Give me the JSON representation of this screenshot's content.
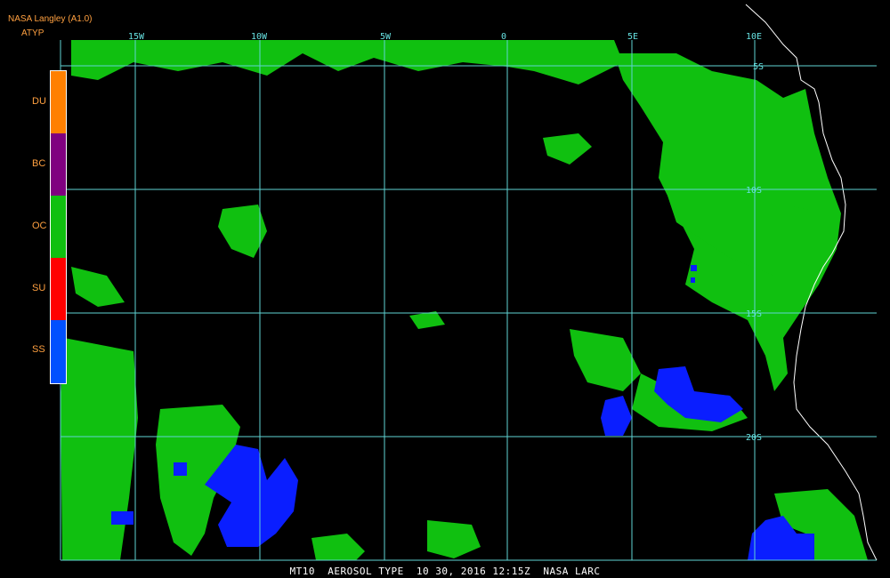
{
  "header": {
    "title": "NASA Langley (A1.0)",
    "subtitle": "ATYP"
  },
  "legend": {
    "items": [
      {
        "label": "DU",
        "color": "#ff8000"
      },
      {
        "label": "BC",
        "color": "#800080"
      },
      {
        "label": "OC",
        "color": "#10c010"
      },
      {
        "label": "SU",
        "color": "#ff0000"
      },
      {
        "label": "SS",
        "color": "#0050ff"
      }
    ]
  },
  "grid": {
    "lon_labels": [
      "15W",
      "10W",
      "5W",
      "0",
      "5E",
      "10E"
    ],
    "lat_labels": [
      "5S",
      "10S",
      "15S",
      "20S"
    ],
    "color": "#5fd3d3"
  },
  "footer": "MT10  AEROSOL TYPE  10 30, 2016 12:15Z  NASA LARC"
}
